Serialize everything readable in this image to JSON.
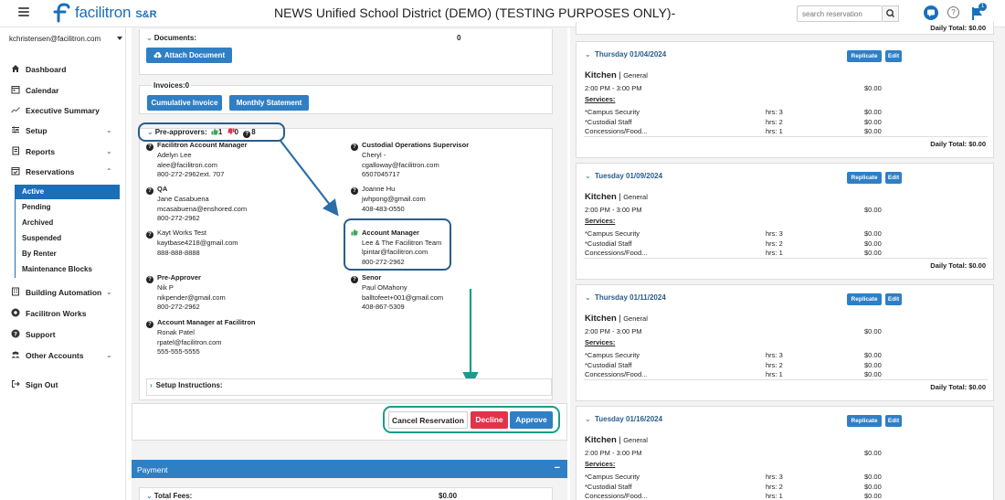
{
  "header": {
    "logo_text": "facilitron",
    "logo_suffix": "S&R",
    "page_title": "NEWS Unified School District (DEMO) (TESTING PURPOSES ONLY)-",
    "search_placeholder": "search reservation",
    "notification_count": "1"
  },
  "sidebar": {
    "user_email": "kchristensen@facilitron.com",
    "items": [
      {
        "label": "Dashboard"
      },
      {
        "label": "Calendar"
      },
      {
        "label": "Executive Summary"
      },
      {
        "label": "Setup"
      },
      {
        "label": "Reports"
      },
      {
        "label": "Reservations"
      },
      {
        "label": "Building Automation"
      },
      {
        "label": "Facilitron Works"
      },
      {
        "label": "Support"
      },
      {
        "label": "Other Accounts"
      },
      {
        "label": "Sign Out"
      }
    ],
    "reservation_subitems": [
      {
        "label": "Active"
      },
      {
        "label": "Pending"
      },
      {
        "label": "Archived"
      },
      {
        "label": "Suspended"
      },
      {
        "label": "By Renter"
      },
      {
        "label": "Maintenance Blocks"
      }
    ]
  },
  "center": {
    "documents_label": "Documents:",
    "documents_count": "0",
    "attach_document_label": "Attach Document",
    "invoices_label": "Invoices:0",
    "cumulative_invoice_label": "Cumulative Invoice",
    "monthly_statement_label": "Monthly Statement",
    "preapprovers_label": "Pre-approvers:",
    "preapprovers_approved": "1",
    "preapprovers_declined": "0",
    "preapprovers_pending": "8",
    "contacts_left": [
      {
        "role": "Facilitron Account Manager",
        "lines": [
          "Adelyn Lee",
          "alee@facilitron.com",
          "800-272-2962ext. 707"
        ]
      },
      {
        "role": "QA",
        "lines": [
          "Jane Casabuena",
          "mcasabuena@enshored.com",
          "800-272-2962"
        ]
      },
      {
        "role": "Kayt Works Test",
        "lines": [
          "kaytbase4218@gmail.com",
          "888-888-8888"
        ]
      },
      {
        "role": "Pre-Approver",
        "lines": [
          "Nik P",
          "nikpender@gmail.com",
          "800-272-2962"
        ]
      },
      {
        "role": "Account Manager at Facilitron",
        "lines": [
          "Ronak Patel",
          "rpatel@facilitron.com",
          "555-555-5555"
        ]
      }
    ],
    "contacts_right": [
      {
        "role": "Custodial Operations Supervisor",
        "lines": [
          "Cheryl -",
          "cgalloway@facilitron.com",
          "6507045717"
        ]
      },
      {
        "role": "Joanne Hu",
        "lines": [
          "jwhpong@gmail.com",
          "408-483-0550"
        ]
      },
      {
        "role": "Account Manager",
        "lines": [
          "Lee & The Facilitron Team",
          "lpintar@facilitron.com",
          "800-272-2962"
        ]
      },
      {
        "role": "Senor",
        "lines": [
          "Paul OMahony",
          "balltofeet+001@gmail.com",
          "408-867-5309"
        ]
      }
    ],
    "setup_instructions_label": "Setup Instructions:",
    "cancel_label": "Cancel Reservation",
    "decline_label": "Decline",
    "approve_label": "Approve",
    "payment_label": "Payment",
    "payment_toggle": "−",
    "total_fees_label": "Total Fees:",
    "total_fees_value": "$0.00"
  },
  "right": {
    "top_daily_total": "Daily Total: $0.00",
    "replicate_label": "Replicate",
    "edit_label": "Edit",
    "days": [
      {
        "date": "Thursday 01/04/2024",
        "venue": "Kitchen",
        "venue_type": "General",
        "time": "2:00 PM - 3:00 PM",
        "time_cost": "$0.00",
        "services_label": "Services:",
        "services": [
          {
            "name": "*Campus Security",
            "hrs": "hrs: 3",
            "cost": "$0.00"
          },
          {
            "name": "*Custodial Staff",
            "hrs": "hrs: 2",
            "cost": "$0.00"
          },
          {
            "name": "Concessions/Food...",
            "hrs": "hrs: 1",
            "cost": "$0.00"
          }
        ],
        "daily_total": "Daily Total: $0.00"
      },
      {
        "date": "Tuesday 01/09/2024",
        "venue": "Kitchen",
        "venue_type": "General",
        "time": "2:00 PM - 3:00 PM",
        "time_cost": "$0.00",
        "services_label": "Services:",
        "services": [
          {
            "name": "*Campus Security",
            "hrs": "hrs: 3",
            "cost": "$0.00"
          },
          {
            "name": "*Custodial Staff",
            "hrs": "hrs: 2",
            "cost": "$0.00"
          },
          {
            "name": "Concessions/Food...",
            "hrs": "hrs: 1",
            "cost": "$0.00"
          }
        ],
        "daily_total": "Daily Total: $0.00"
      },
      {
        "date": "Thursday 01/11/2024",
        "venue": "Kitchen",
        "venue_type": "General",
        "time": "2:00 PM - 3:00 PM",
        "time_cost": "$0.00",
        "services_label": "Services:",
        "services": [
          {
            "name": "*Campus Security",
            "hrs": "hrs: 3",
            "cost": "$0.00"
          },
          {
            "name": "*Custodial Staff",
            "hrs": "hrs: 2",
            "cost": "$0.00"
          },
          {
            "name": "Concessions/Food...",
            "hrs": "hrs: 1",
            "cost": "$0.00"
          }
        ],
        "daily_total": "Daily Total: $0.00"
      },
      {
        "date": "Tuesday 01/16/2024",
        "venue": "Kitchen",
        "venue_type": "General",
        "time": "2:00 PM - 3:00 PM",
        "time_cost": "$0.00",
        "services_label": "Services:",
        "services": [
          {
            "name": "*Campus Security",
            "hrs": "hrs: 3",
            "cost": "$0.00"
          },
          {
            "name": "*Custodial Staff",
            "hrs": "hrs: 2",
            "cost": "$0.00"
          },
          {
            "name": "Concessions/Food...",
            "hrs": "hrs: 1",
            "cost": "$0.00"
          }
        ],
        "daily_total": ""
      }
    ]
  },
  "colors": {
    "brand_blue": "#1b6fb9",
    "button_blue": "#2f7fc5",
    "decline_red": "#e0344a",
    "annotation_dark_blue": "#2a5d8c",
    "annotation_teal": "#1d9b8a",
    "approved_green": "#3aa655"
  }
}
